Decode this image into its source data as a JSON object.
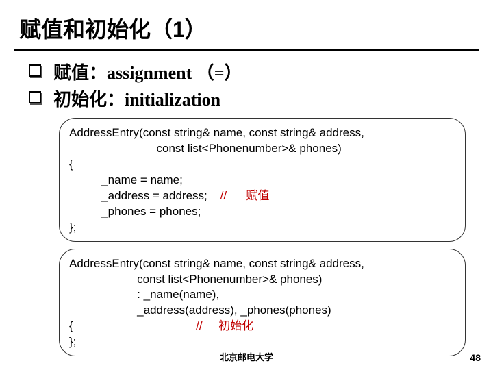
{
  "title": "赋值和初始化（1）",
  "bullets": [
    "赋值：assignment （=）",
    "初始化：initialization"
  ],
  "code1": {
    "l1": "AddressEntry(const string& name, const string& address,",
    "l2": "                           const list<Phonenumber>& phones)",
    "l3": "{",
    "l4": "          _name = name;",
    "l5a": "          _address = address;    ",
    "l5b": "//      赋值",
    "l6": "          _phones = phones;",
    "l7": "};"
  },
  "code2": {
    "l1": "AddressEntry(const string& name, const string& address,",
    "l2": "                     const list<Phonenumber>& phones)",
    "l3": "                     : _name(name),",
    "l4": "                     _address(address), _phones(phones)",
    "l5a": "{                                      ",
    "l5b": "//     初始化",
    "l6": "};"
  },
  "footer": "北京邮电大学",
  "pagenum": "48"
}
